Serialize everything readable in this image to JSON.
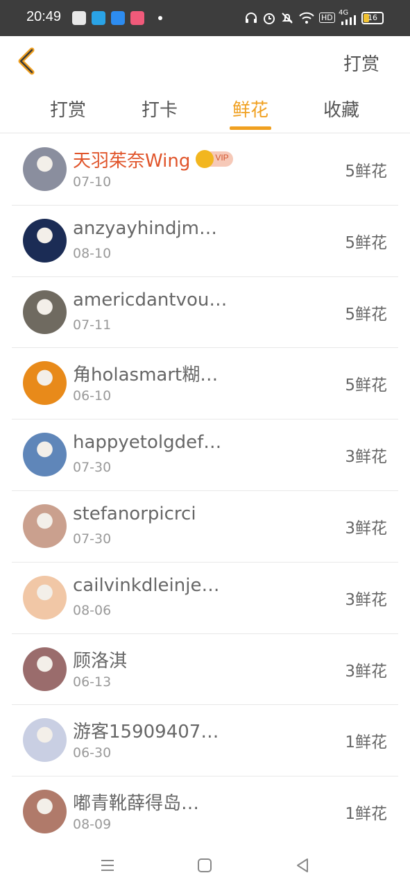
{
  "status_bar": {
    "time": "20:49",
    "network": "4G",
    "hd": "HD",
    "battery": "16",
    "icons": [
      "app-icon",
      "telegram-icon",
      "browser-icon",
      "video-icon",
      "headset-icon",
      "alarm-icon",
      "mute-icon",
      "wifi-icon",
      "hd-icon",
      "signal-icon",
      "battery-icon"
    ]
  },
  "header": {
    "back_icon": "chevron-left-icon",
    "action_label": "打赏"
  },
  "tabs": [
    {
      "label": "打赏",
      "active": false
    },
    {
      "label": "打卡",
      "active": false
    },
    {
      "label": "鲜花",
      "active": true
    },
    {
      "label": "收藏",
      "active": false
    }
  ],
  "list": [
    {
      "name": "天羽茱奈Wing",
      "date": "07-10",
      "amount": "5鲜花",
      "vip": true,
      "vip_label": "VIP",
      "avatar_color": "#8a8e9e"
    },
    {
      "name": "anzyayhindjm…",
      "date": "08-10",
      "amount": "5鲜花",
      "vip": false,
      "avatar_color": "#1b2c55"
    },
    {
      "name": "americdantvou…",
      "date": "07-11",
      "amount": "5鲜花",
      "vip": false,
      "avatar_color": "#6f6a60"
    },
    {
      "name": "角holasmart糊…",
      "date": "06-10",
      "amount": "5鲜花",
      "vip": false,
      "avatar_color": "#e88a1a"
    },
    {
      "name": "happyetolgdef…",
      "date": "07-30",
      "amount": "3鲜花",
      "vip": false,
      "avatar_color": "#5f86b9"
    },
    {
      "name": "stefanorpicrci",
      "date": "07-30",
      "amount": "3鲜花",
      "vip": false,
      "avatar_color": "#caa08e"
    },
    {
      "name": "cailvinkdleinje…",
      "date": "08-06",
      "amount": "3鲜花",
      "vip": false,
      "avatar_color": "#f1c7a6"
    },
    {
      "name": "顾洛淇",
      "date": "06-13",
      "amount": "3鲜花",
      "vip": false,
      "avatar_color": "#9a6c6c"
    },
    {
      "name": "游客15909407…",
      "date": "06-30",
      "amount": "1鲜花",
      "vip": false,
      "avatar_color": "#c9cfe3"
    },
    {
      "name": "嘟青靴薛得岛…",
      "date": "08-09",
      "amount": "1鲜花",
      "vip": false,
      "avatar_color": "#b07a6a"
    }
  ],
  "bottom_nav": {
    "icons": [
      "menu-icon",
      "home-icon",
      "back-triangle-icon"
    ]
  },
  "colors": {
    "accent": "#f0a020",
    "vip_name": "#e0542a",
    "status_bar": "#3d3d3d"
  }
}
